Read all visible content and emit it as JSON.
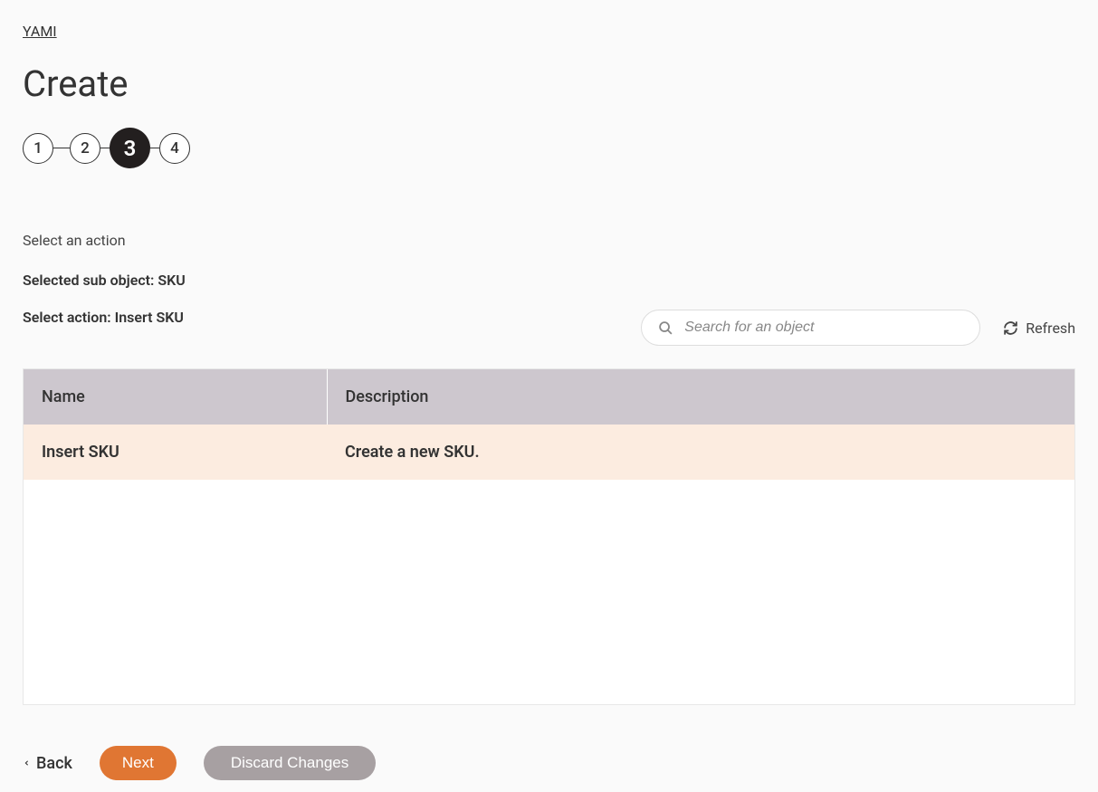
{
  "breadcrumb": "YAMI",
  "page_title": "Create",
  "stepper": {
    "steps": [
      "1",
      "2",
      "3",
      "4"
    ],
    "active_index": 2
  },
  "instruction": "Select an action",
  "selected_sub_object_label": "Selected sub object: SKU",
  "select_action_label": "Select action: Insert SKU",
  "search": {
    "placeholder": "Search for an object"
  },
  "refresh_label": "Refresh",
  "table": {
    "headers": {
      "name": "Name",
      "description": "Description"
    },
    "rows": [
      {
        "name": "Insert SKU",
        "description": "Create a new SKU."
      }
    ]
  },
  "footer": {
    "back": "Back",
    "next": "Next",
    "discard": "Discard Changes"
  }
}
